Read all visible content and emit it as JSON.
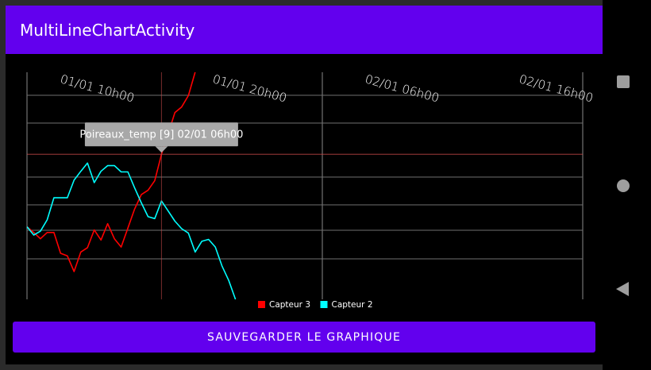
{
  "app": {
    "title": "MultiLineChartActivity"
  },
  "button": {
    "label": "SAUVEGARDER LE GRAPHIQUE"
  },
  "navigation": {
    "recents_icon": "square",
    "home_icon": "circle",
    "back_icon": "triangle-left"
  },
  "chart_data": {
    "type": "line",
    "x_tick_labels": [
      "01/01 10h00",
      "01/01 20h00",
      "02/01 06h00",
      "02/01 16h00"
    ],
    "tooltip": "Poireaux_temp [9] 02/01 06h00",
    "series": [
      {
        "name": "Capteur 3",
        "color": "#ff0000",
        "values": [
          26.5,
          25.6,
          24.6,
          25.6,
          25.6,
          22.3,
          21.9,
          19.4,
          22.5,
          23.2,
          26.0,
          24.4,
          27.0,
          24.6,
          23.3,
          26.3,
          29.3,
          31.6,
          32.3,
          33.8,
          38.0,
          41.3,
          44.6,
          45.5,
          47.3,
          51.0
        ]
      },
      {
        "name": "Capteur 2",
        "color": "#00ffff",
        "values": [
          26.5,
          25.2,
          25.8,
          27.6,
          31.1,
          31.1,
          31.1,
          33.9,
          35.3,
          36.6,
          33.5,
          35.3,
          36.2,
          36.2,
          35.2,
          35.2,
          32.7,
          30.3,
          28.1,
          27.8,
          30.6,
          29.0,
          27.4,
          26.2,
          25.5,
          22.5,
          24.2,
          24.5,
          23.3,
          20.3,
          18.0,
          15.0
        ]
      }
    ],
    "highlight_index": 20,
    "grid": true
  }
}
